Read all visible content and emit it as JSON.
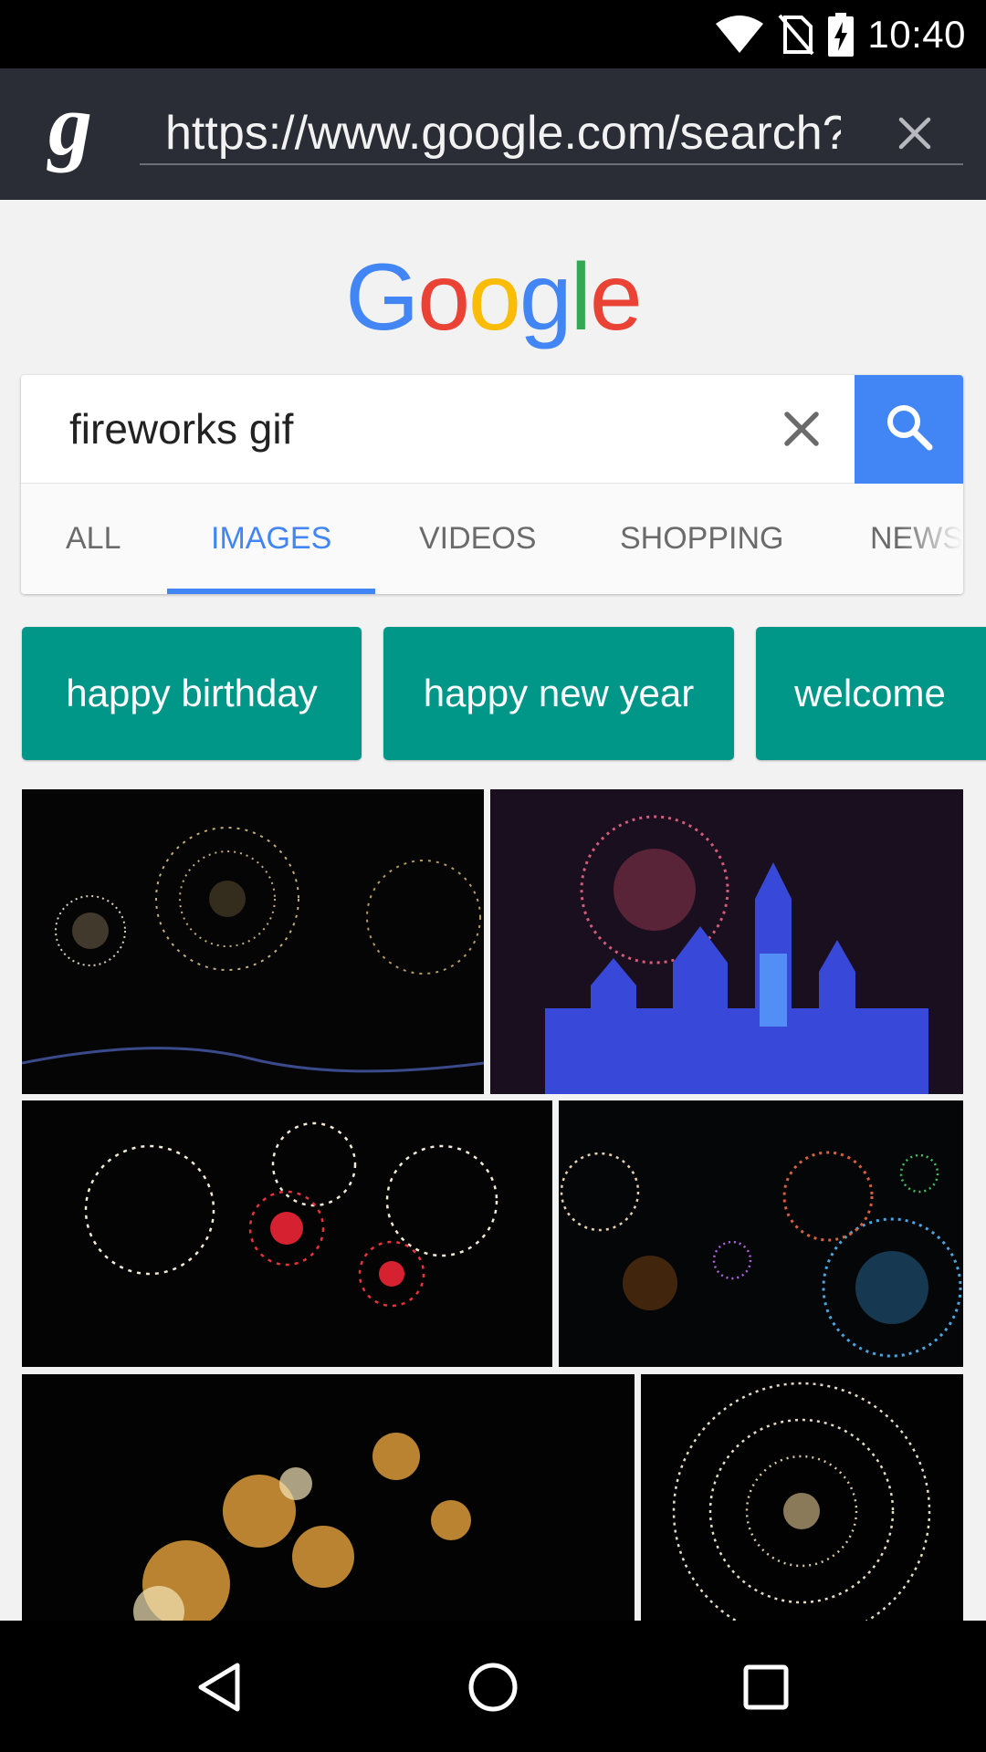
{
  "status_bar": {
    "time": "10:40",
    "icons": [
      "wifi-icon",
      "no-sim-icon",
      "battery-charging-icon"
    ]
  },
  "address_bar": {
    "logo": "g",
    "url": "https://www.google.com/search?q=fireworks+gif&tbm=isch",
    "clear_icon": "close-icon"
  },
  "google_logo": {
    "letters": [
      "G",
      "o",
      "o",
      "g",
      "l",
      "e"
    ],
    "colors": [
      "#4285f4",
      "#ea4335",
      "#fbbc05",
      "#4285f4",
      "#34a853",
      "#ea4335"
    ]
  },
  "search": {
    "query": "fireworks gif",
    "clear_icon": "close-icon",
    "submit_icon": "search-icon"
  },
  "tabs": [
    {
      "label": "ALL",
      "active": false
    },
    {
      "label": "IMAGES",
      "active": true
    },
    {
      "label": "VIDEOS",
      "active": false
    },
    {
      "label": "SHOPPING",
      "active": false
    },
    {
      "label": "NEWS",
      "active": false
    }
  ],
  "suggestions": [
    "happy birthday",
    "happy new year",
    "welcome"
  ],
  "colors": {
    "accent": "#4285f4",
    "chip": "#009688",
    "address_bar": "#2b2d36"
  },
  "results": [
    {
      "subject": "golden fireworks over a bridge"
    },
    {
      "subject": "fireworks above a blue castle"
    },
    {
      "subject": "white and red fireworks"
    },
    {
      "subject": "multicolored fireworks"
    },
    {
      "subject": "golden fireworks burst"
    },
    {
      "subject": "single white firework"
    }
  ],
  "nav_bar": [
    "back-icon",
    "home-icon",
    "recents-icon"
  ]
}
